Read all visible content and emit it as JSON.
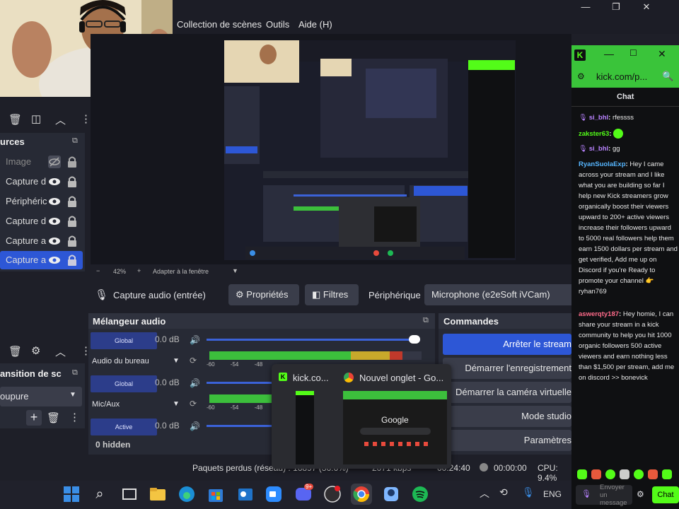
{
  "menu": {
    "scenes": "Collection de scènes",
    "tools": "Outils",
    "help": "Aide (H)"
  },
  "window_controls": {
    "minimize": "—",
    "maximize": "❐",
    "close": "✕"
  },
  "sources": {
    "title": "urces",
    "items": [
      {
        "label": "Image",
        "hidden": true
      },
      {
        "label": "Capture d"
      },
      {
        "label": "Périphéric"
      },
      {
        "label": "Capture d"
      },
      {
        "label": "Capture a"
      },
      {
        "label": "Capture a",
        "selected": true
      }
    ]
  },
  "transitions": {
    "title": "ansition de sc",
    "selected": "oupure"
  },
  "zoom": {
    "value": "42%",
    "label": "Adapter à la fenêtre"
  },
  "source_toolbar": {
    "name": "Capture audio (entrée)",
    "properties": "Propriétés",
    "filters": "Filtres",
    "device_label": "Périphérique",
    "device_value": "Microphone (e2eSoft iVCam)"
  },
  "mixer": {
    "title": "Mélangeur audio",
    "tracks": [
      {
        "button": "Global",
        "db": "0.0 dB",
        "name": "Audio du bureau",
        "level": 0.91
      },
      {
        "button": "Global",
        "db": "0.0 dB",
        "name": "Mic/Aux",
        "level": 0.3
      },
      {
        "button": "Active",
        "db": "0.0 dB",
        "name": "",
        "level": 0
      }
    ],
    "scale": [
      "-60",
      "-54",
      "-48"
    ],
    "hidden": "0 hidden"
  },
  "commands": {
    "title": "Commandes",
    "buttons": [
      "Arrêter le stream",
      "Démarrer l'enregistrement",
      "Démarrer la caméra virtuelle",
      "Mode studio",
      "Paramètres"
    ]
  },
  "status": {
    "dropped": "Paquets perdus (réseau) : 16897 (36.6%)",
    "bitrate": "2071 kbps",
    "stream_time": "00:24:40",
    "rec_time": "00:00:00",
    "cpu": "CPU: 9.4%"
  },
  "taskbar": {
    "language": "ENG",
    "discord_badge": "9+"
  },
  "task_preview": {
    "kick_title": "kick.co...",
    "chrome_title": "Nouvel onglet - Go...",
    "google": "Google"
  },
  "chat": {
    "url": "kick.com/p...",
    "header": "Chat",
    "messages": [
      {
        "user": "si_bhl",
        "text": "rfessss",
        "color": "#b983ff"
      },
      {
        "user": "zakster63",
        "text": "",
        "color": "#53fc18"
      },
      {
        "user": "si_bhl",
        "text": "gg",
        "color": "#b983ff"
      },
      {
        "user": "RyanSuolaExp",
        "text": "Hey I came across your stream and I like what you are building so far I help new Kick streamers grow organically boost their viewers upward to 200+ active viewers increase their followers upward to 5000 real followers help them earn 1500 dollars per stream and get verified, Add me up on Discord if you're Ready to promote your channel 👉 ryhan769",
        "color": "#56b6ff"
      },
      {
        "user": "aswerqty187",
        "text": "Hey homie, I can share your stream in a kick community to help you hit 1000 organic followers 500 active viewers and earn nothing less than $1,500 per stream, add me on discord >> bonevick",
        "color": "#ff6b8a"
      }
    ],
    "input_placeholder": "Envoyer un message",
    "send": "Chat"
  },
  "colors": {
    "kick_green": "#53fc18",
    "obs_blue": "#2d57d6",
    "panel": "#272a35"
  }
}
